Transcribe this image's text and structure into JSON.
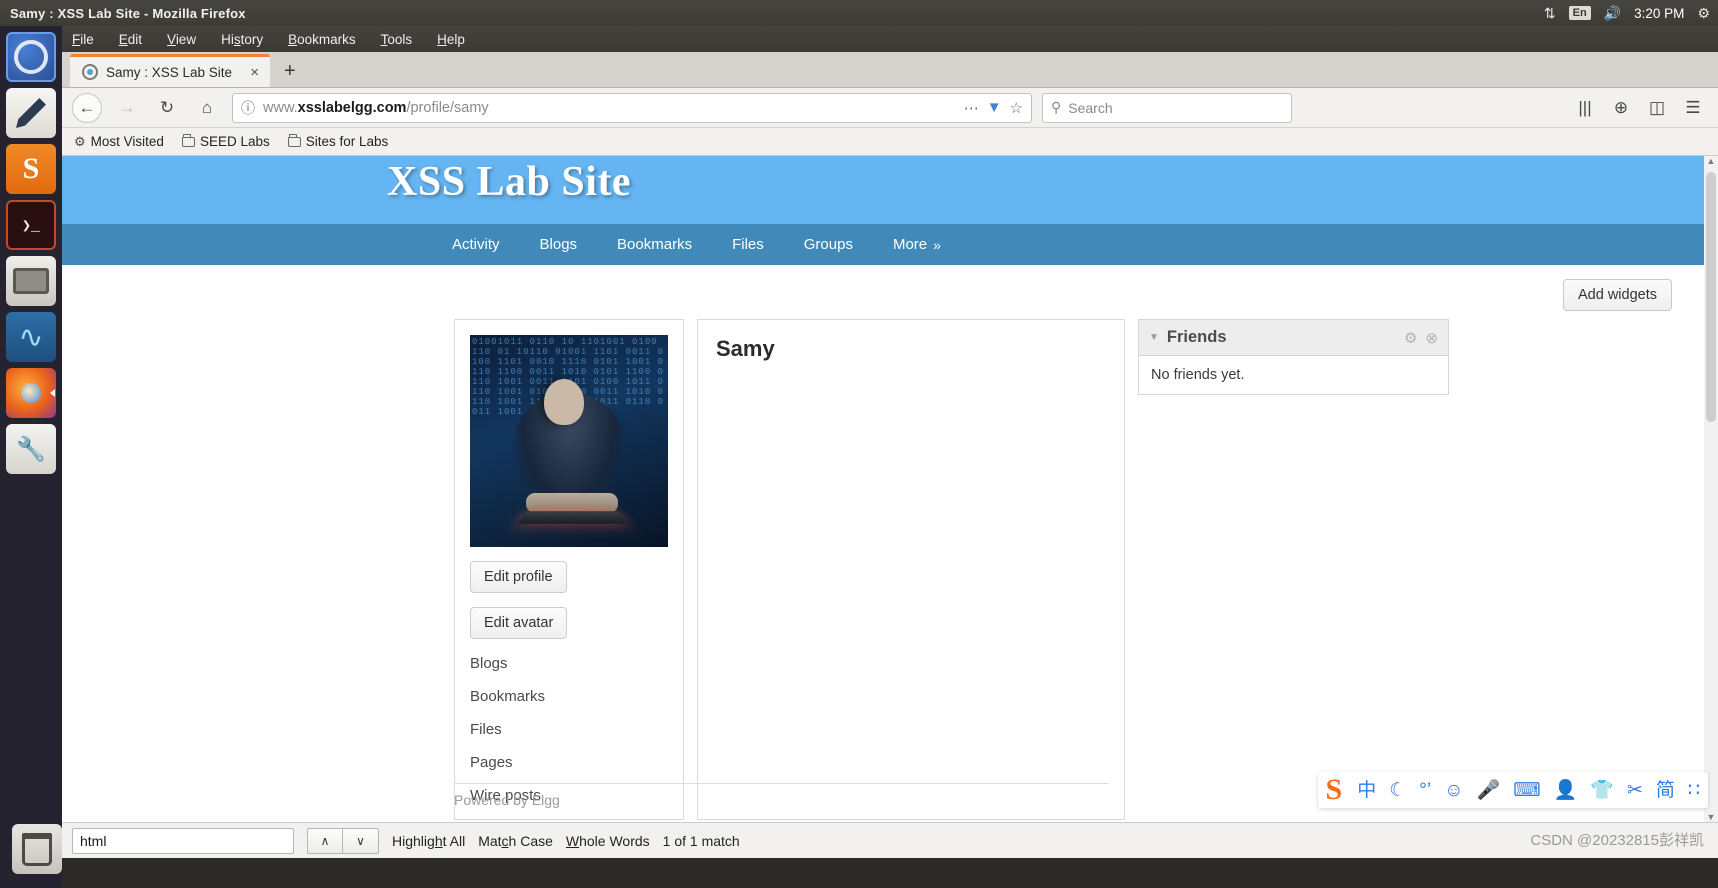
{
  "window": {
    "title": "Samy : XSS Lab Site - Mozilla Firefox"
  },
  "tray": {
    "network_icon": "⇅",
    "language": "En",
    "volume_icon": "🔊",
    "clock": "3:20 PM",
    "gear_icon": "⚙"
  },
  "launcher": {
    "items": [
      {
        "name": "ubuntu-dash",
        "label": "Ubuntu Dash"
      },
      {
        "name": "text-editor",
        "label": "Text Editor"
      },
      {
        "name": "ubuntu-software",
        "label": "Ubuntu Software"
      },
      {
        "name": "terminal",
        "label": "Terminal"
      },
      {
        "name": "archive-manager",
        "label": "Archive Manager"
      },
      {
        "name": "wireshark",
        "label": "Wireshark"
      },
      {
        "name": "firefox",
        "label": "Firefox"
      },
      {
        "name": "system-tools",
        "label": "System Tools"
      },
      {
        "name": "trash",
        "label": "Trash"
      }
    ]
  },
  "menubar": {
    "items": [
      "File",
      "Edit",
      "View",
      "History",
      "Bookmarks",
      "Tools",
      "Help"
    ],
    "accels": [
      "F",
      "E",
      "V",
      "s",
      "B",
      "T",
      "H"
    ]
  },
  "tabs": {
    "active": {
      "title": "Samy : XSS Lab Site",
      "close_label": "×"
    },
    "new_tab_label": "+"
  },
  "navbar": {
    "back_icon": "←",
    "forward_icon": "→",
    "reload_icon": "↻",
    "home_icon": "⌂",
    "url_prefix": "www.",
    "url_host": "xsslabelgg.com",
    "url_path": "/profile/samy",
    "info_icon": "ⓘ",
    "page_actions_icon": "⋯",
    "pocket_icon": "▼",
    "bookmark_star_icon": "☆",
    "search_placeholder": "Search",
    "search_icon": "⚲",
    "library_icon": "|||",
    "account_icon": "⊕",
    "sidebar_icon": "◫",
    "menu_icon": "☰"
  },
  "bookmarks": [
    {
      "label": "Most Visited",
      "icon": "star-icon"
    },
    {
      "label": "SEED Labs",
      "icon": "folder-icon"
    },
    {
      "label": "Sites for Labs",
      "icon": "folder-icon"
    }
  ],
  "site": {
    "title": "XSS Lab Site",
    "nav": [
      "Activity",
      "Blogs",
      "Bookmarks",
      "Files",
      "Groups"
    ],
    "more_label": "More",
    "more_chevron": "»",
    "add_widgets_label": "Add widgets",
    "footer": "Powered by Elgg",
    "colors": {
      "header_blue": "#64b5f1",
      "nav_blue": "#4089b8"
    }
  },
  "profile": {
    "username": "Samy",
    "buttons": [
      "Edit profile",
      "Edit avatar"
    ],
    "links": [
      "Blogs",
      "Bookmarks",
      "Files",
      "Pages",
      "Wire posts"
    ]
  },
  "widget": {
    "title": "Friends",
    "caret_icon": "▼",
    "settings_icon": "⚙",
    "close_icon": "⊗",
    "body_text": "No friends yet."
  },
  "ime": {
    "logo": "S",
    "items": [
      "中",
      "☾",
      "°’",
      "☺",
      "🎤",
      "⌨",
      "👤",
      "👕",
      "✂",
      "简",
      "∷"
    ]
  },
  "findbar": {
    "query": "html",
    "prev_icon": "∧",
    "next_icon": "∨",
    "highlight_all": "Highlight All",
    "match_case": "Match Case",
    "whole_words": "Whole Words",
    "status": "1 of 1 match"
  },
  "watermark": "CSDN @20232815彭祥凯"
}
